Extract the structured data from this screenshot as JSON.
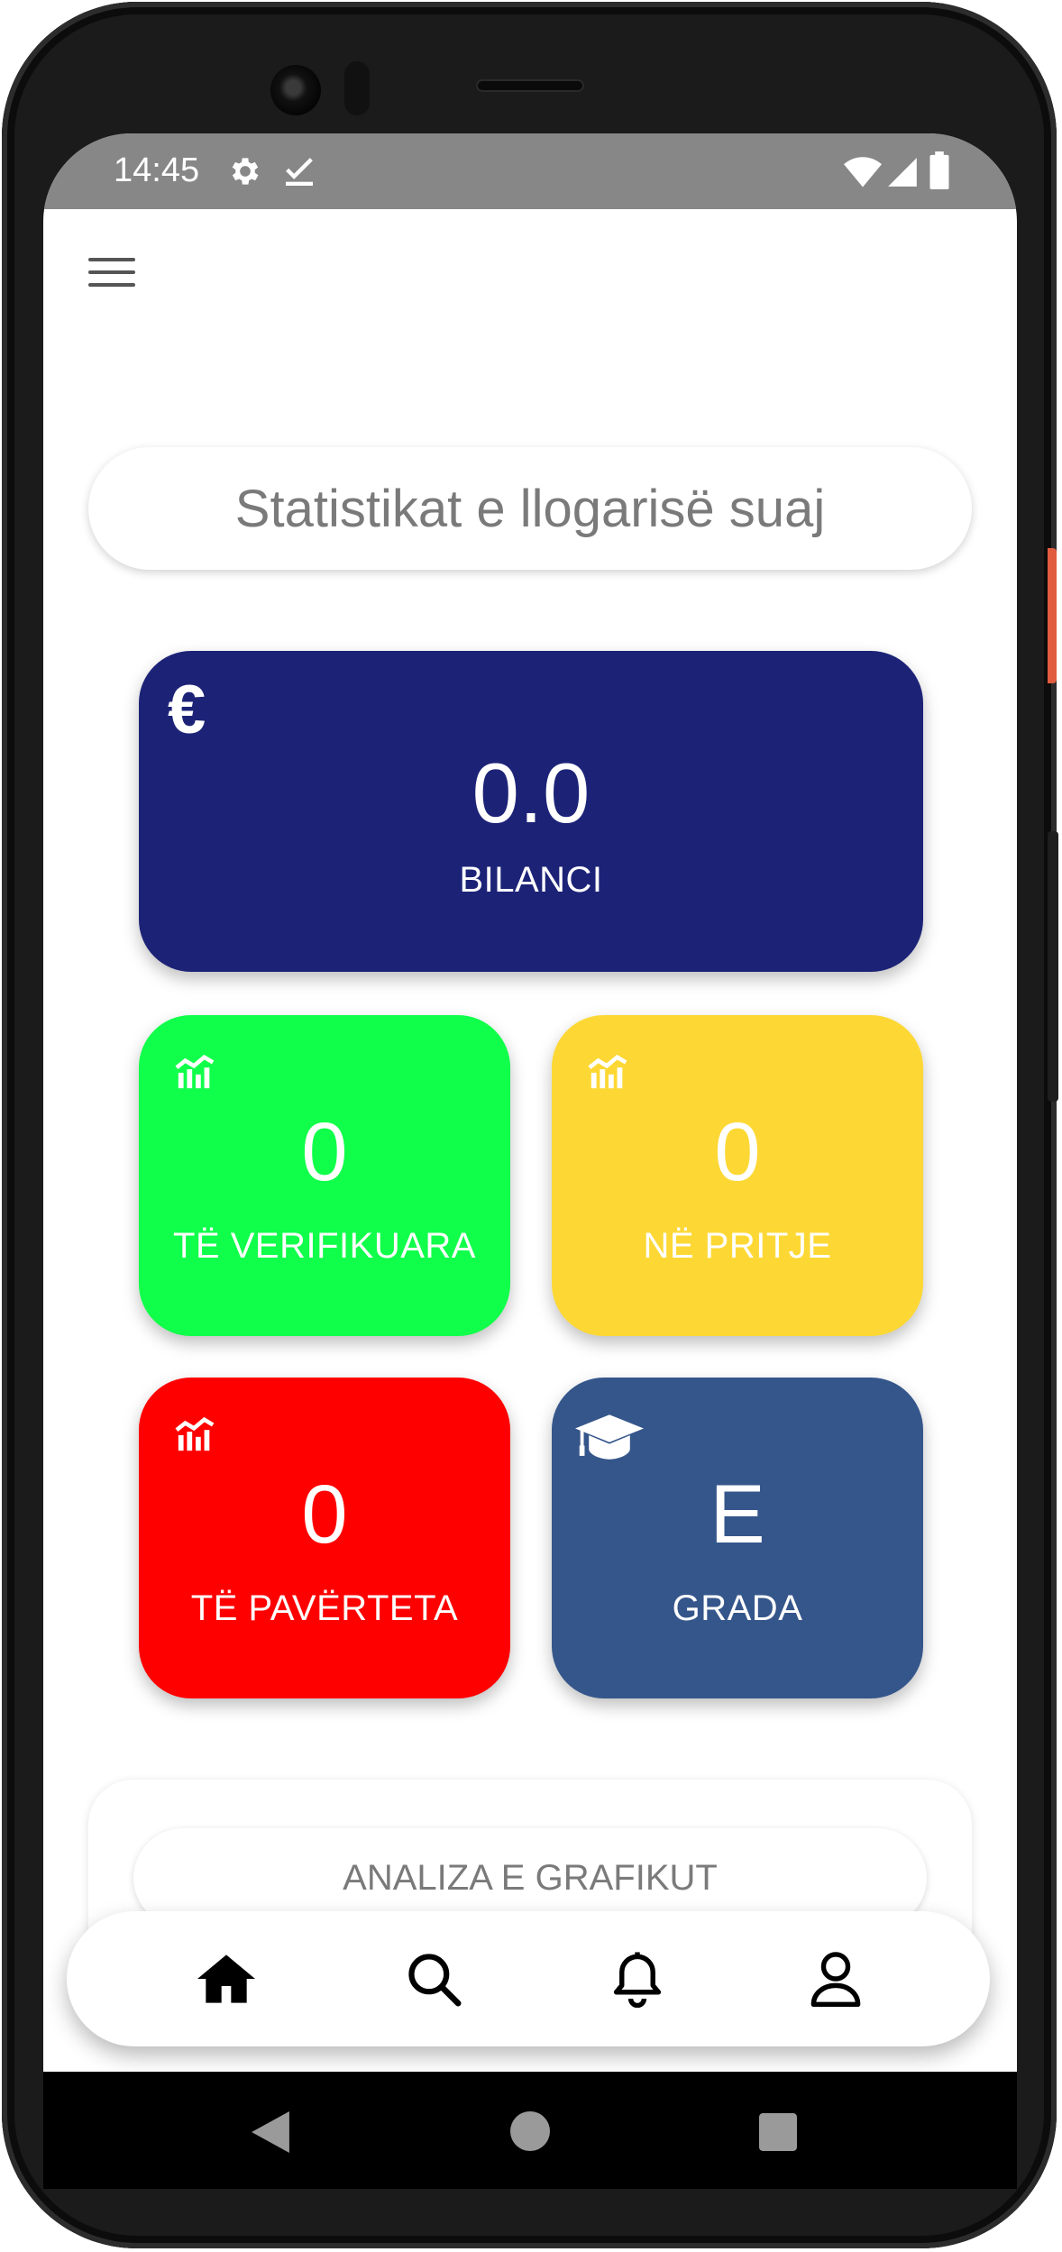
{
  "status_bar": {
    "time": "14:45",
    "icons": [
      "gear-icon",
      "checkmark-icon",
      "wifi-icon",
      "cell-signal-icon",
      "battery-icon"
    ]
  },
  "header": {
    "menu_icon": "hamburger-menu-icon",
    "title": "Statistikat e llogarisë suaj"
  },
  "cards": {
    "balance": {
      "icon": "euro-icon",
      "value": "0.0",
      "label": "BILANCI",
      "color": "#1c2377"
    },
    "verified": {
      "icon": "chart-icon",
      "value": "0",
      "label": "TË VERIFIKUARA",
      "color": "#10ff4a"
    },
    "pending": {
      "icon": "chart-icon",
      "value": "0",
      "label": "NË PRITJE",
      "color": "#fdd835"
    },
    "invalid": {
      "icon": "chart-icon",
      "value": "0",
      "label": "TË PAVËRTETA",
      "color": "#ff0000"
    },
    "grade": {
      "icon": "graduation-cap-icon",
      "value": "E",
      "label": "GRADA",
      "color": "#35568b"
    }
  },
  "graph_section": {
    "button_label": "ANALIZA E GRAFIKUT"
  },
  "bottom_nav": {
    "items": [
      {
        "icon": "home-icon",
        "active": true
      },
      {
        "icon": "search-icon",
        "active": false
      },
      {
        "icon": "bell-icon",
        "active": false
      },
      {
        "icon": "profile-icon",
        "active": false
      }
    ]
  },
  "system_nav": [
    "back-icon",
    "home-circle-icon",
    "recents-icon"
  ]
}
